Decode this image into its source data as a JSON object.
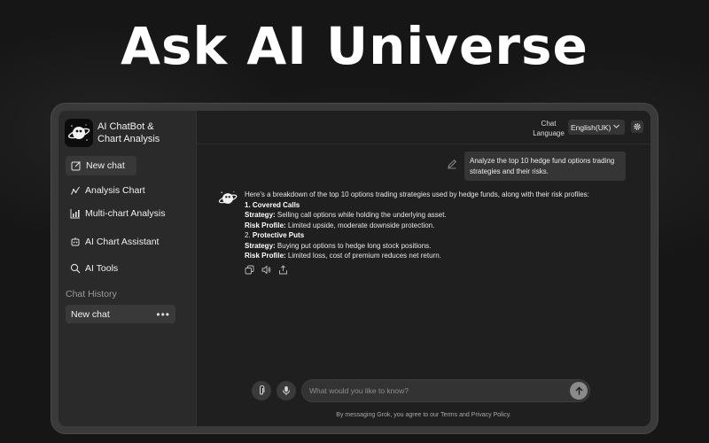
{
  "hero": {
    "title": "Ask AI Universe"
  },
  "app": {
    "brand_line1": "AI ChatBot &",
    "brand_line2": "Chart Analysis",
    "logo_icon": "planet-icon"
  },
  "sidebar": {
    "new_chat_label": "New chat",
    "items": [
      {
        "label": "Analysis Chart",
        "icon": "chart-icon"
      },
      {
        "label": "Multi-chart Analysis",
        "icon": "bar-chart-icon"
      },
      {
        "label": "AI Chart Assistant",
        "icon": "robot-icon"
      },
      {
        "label": "AI Tools",
        "icon": "search-icon"
      }
    ],
    "history_title": "Chat History",
    "history": [
      {
        "label": "New chat",
        "menu": "•••"
      }
    ]
  },
  "topbar": {
    "language_label_line1": "Chat",
    "language_label_line2": "Language",
    "language_value": "English(UK)"
  },
  "conversation": {
    "user_message": "Analyze the top 10 hedge fund options trading strategies and their risks.",
    "ai_intro": "Here's a breakdown of the top 10 options trading strategies used by hedge funds, along with their risk profiles:",
    "strategies": [
      {
        "title": "1. Covered Calls",
        "strategy_label": "Strategy:",
        "strategy_text": " Selling call options while holding the underlying asset.",
        "risk_label": "Risk Profile:",
        "risk_text": " Limited upside, moderate downside protection."
      },
      {
        "title_num": "2.",
        "title_name": " Protective Puts",
        "strategy_label": "Strategy:",
        "strategy_text": " Buying put options to hedge long stock positions.",
        "risk_label": "Risk Profile:",
        "risk_text": " Limited loss, cost of premium reduces net return."
      }
    ]
  },
  "composer": {
    "placeholder": "What would you like to know?",
    "disclaimer": "By messaging Grok, you agree to our Terms and Privacy Policy."
  }
}
